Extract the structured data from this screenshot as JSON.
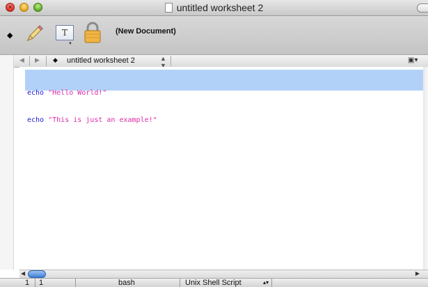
{
  "window": {
    "title": "untitled worksheet 2"
  },
  "toolbar": {
    "document_status": "(New Document)"
  },
  "navbar": {
    "document_name": "untitled worksheet 2"
  },
  "editor": {
    "lines": [
      {
        "keyword": "echo",
        "string": "\"Hello World!\""
      },
      {
        "keyword": "echo",
        "string": "\"This is just an example!\""
      }
    ],
    "colors": {
      "keyword": "#1b1bd6",
      "string": "#e02aa9",
      "selection": "#b2d1f8"
    }
  },
  "statusbar": {
    "line": "1",
    "column": "1",
    "shell": "bash",
    "language": "Unix Shell Script"
  }
}
